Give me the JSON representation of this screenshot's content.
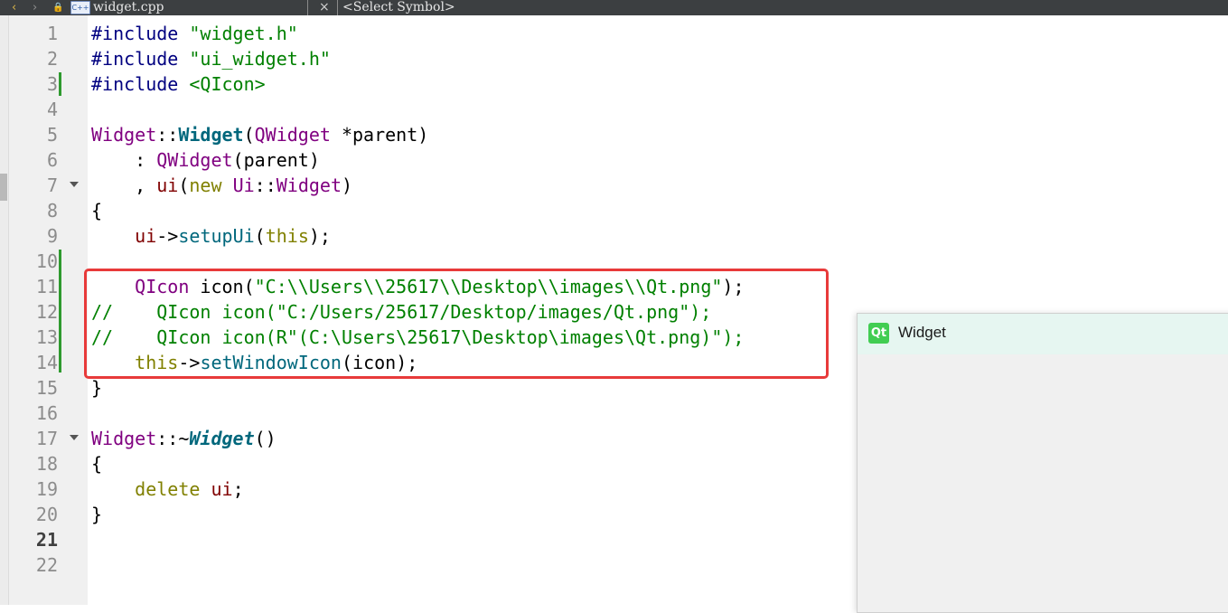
{
  "toolbar": {
    "back_icon": "‹",
    "forward_icon": "›",
    "lock_icon": "🔒",
    "file_type_icon": "C++",
    "file_name": "widget.cpp",
    "close_icon": "×",
    "symbol_selector": "<Select Symbol>"
  },
  "editor": {
    "current_line": 21,
    "line_numbers": [
      "1",
      "2",
      "3",
      "4",
      "5",
      "6",
      "7",
      "8",
      "9",
      "10",
      "11",
      "12",
      "13",
      "14",
      "15",
      "16",
      "17",
      "18",
      "19",
      "20",
      "21",
      "22"
    ],
    "lines": {
      "l1": {
        "kw": "#include",
        "rest": " \"widget.h\""
      },
      "l2": {
        "kw": "#include",
        "rest": " \"ui_widget.h\""
      },
      "l3": {
        "kw": "#include",
        "rest": " <QIcon>"
      },
      "l5": {
        "cls": "Widget",
        "sep": "::",
        "ctor": "Widget",
        "open": "(",
        "type": "QWidget",
        "param": " *parent",
        "close": ")"
      },
      "l6": {
        "indent": "    : ",
        "type": "QWidget",
        "rest": "(parent)"
      },
      "l7": {
        "indent": "    , ",
        "mem": "ui",
        "open": "(",
        "kw": "new",
        "sp": " ",
        "ns": "Ui",
        "sep": "::",
        "type": "Widget",
        "close": ")"
      },
      "l8": {
        "text": "{"
      },
      "l9": {
        "indent": "    ",
        "mem": "ui",
        "arrow": "->",
        "fn": "setupUi",
        "open": "(",
        "kw": "this",
        "close": ");"
      },
      "l11": {
        "indent": "    ",
        "type": "QIcon",
        "mid": " icon(",
        "str": "\"C:\\\\Users\\\\25617\\\\Desktop\\\\images\\\\Qt.png\"",
        "close": ");"
      },
      "l12": {
        "comment": "//    QIcon icon(\"C:/Users/25617/Desktop/images/Qt.png\");"
      },
      "l13": {
        "comment": "//    QIcon icon(R\"(C:\\Users\\25617\\Desktop\\images\\Qt.png)\");"
      },
      "l14": {
        "indent": "    ",
        "kw": "this",
        "arrow": "->",
        "fn": "setWindowIcon",
        "rest": "(icon);"
      },
      "l15": {
        "text": "}"
      },
      "l17": {
        "cls": "Widget",
        "sep": "::~",
        "ctor": "Widget",
        "rest": "()"
      },
      "l18": {
        "text": "{"
      },
      "l19": {
        "indent": "    ",
        "kw": "delete",
        "sp": " ",
        "mem": "ui",
        "rest": ";"
      },
      "l20": {
        "text": "}"
      }
    }
  },
  "qt_window": {
    "logo_text": "Qt",
    "title": "Widget"
  },
  "colors": {
    "highlight_border": "#e83a3a",
    "change_bar": "#2f9a2f",
    "qt_green": "#41cd52"
  }
}
